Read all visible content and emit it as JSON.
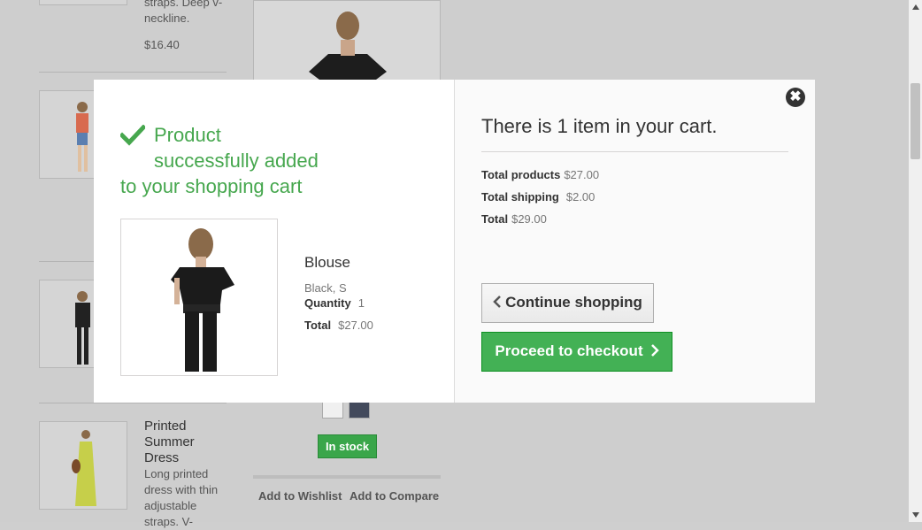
{
  "background": {
    "top_product": {
      "desc_tail": "straps. Deep v-",
      "desc_tail2": "neckline.",
      "price": "$16.40"
    },
    "printed_summer_dress": {
      "name_lines": [
        "Printed",
        "Summer",
        "Dress"
      ],
      "desc_lines": [
        "Long printed",
        "dress with thin",
        "adjustable",
        "straps. V-"
      ]
    },
    "stock_badge": "In stock",
    "wishlist_link": "Add to Wishlist",
    "compare_link": "Add to Compare"
  },
  "modal": {
    "success_lines": [
      "Product",
      "successfully added",
      "to your shopping cart"
    ],
    "product": {
      "name": "Blouse",
      "attributes": "Black, S",
      "quantity_label": "Quantity",
      "quantity_value": "1",
      "total_label": "Total",
      "total_value": "$27.00"
    },
    "cart": {
      "title": "There is 1 item in your cart.",
      "total_products_label": "Total products",
      "total_products_value": "$27.00",
      "total_shipping_label": "Total shipping",
      "total_shipping_value": "$2.00",
      "total_label": "Total",
      "total_value": "$29.00"
    },
    "continue_label": "Continue shopping",
    "checkout_label": "Proceed to checkout",
    "close_symbol": "✖"
  },
  "colors": {
    "success_green": "#46a74e",
    "checkout_green": "#43b155",
    "overlay_gray": "#cecece"
  },
  "icons": {
    "success": "checkmark-icon",
    "close": "close-icon",
    "continue": "chevron-left-icon",
    "checkout": "chevron-right-icon"
  }
}
